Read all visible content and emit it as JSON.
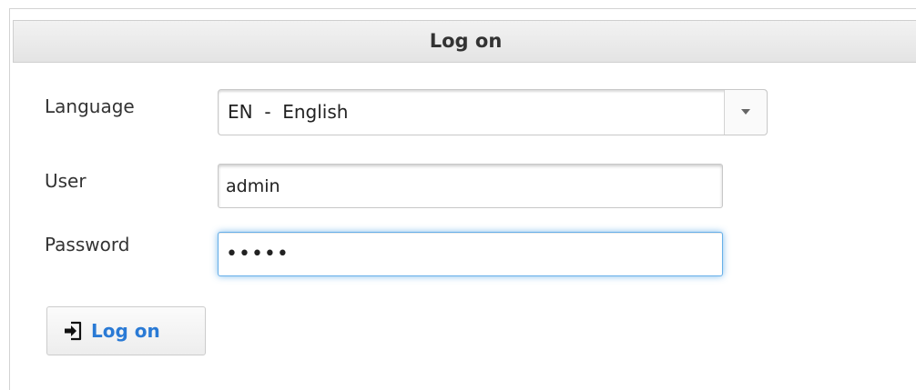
{
  "panel": {
    "title": "Log on"
  },
  "form": {
    "language_label": "Language",
    "language_value": "EN  -  English",
    "user_label": "User",
    "user_value": "admin",
    "password_label": "Password",
    "password_value": "•••••"
  },
  "buttons": {
    "logon_label": "Log on",
    "logon_icon": "sign-in-icon"
  },
  "colors": {
    "accent": "#2a7ad5",
    "focus_ring": "#66afe9",
    "header_bg": "#e8e8e8"
  }
}
